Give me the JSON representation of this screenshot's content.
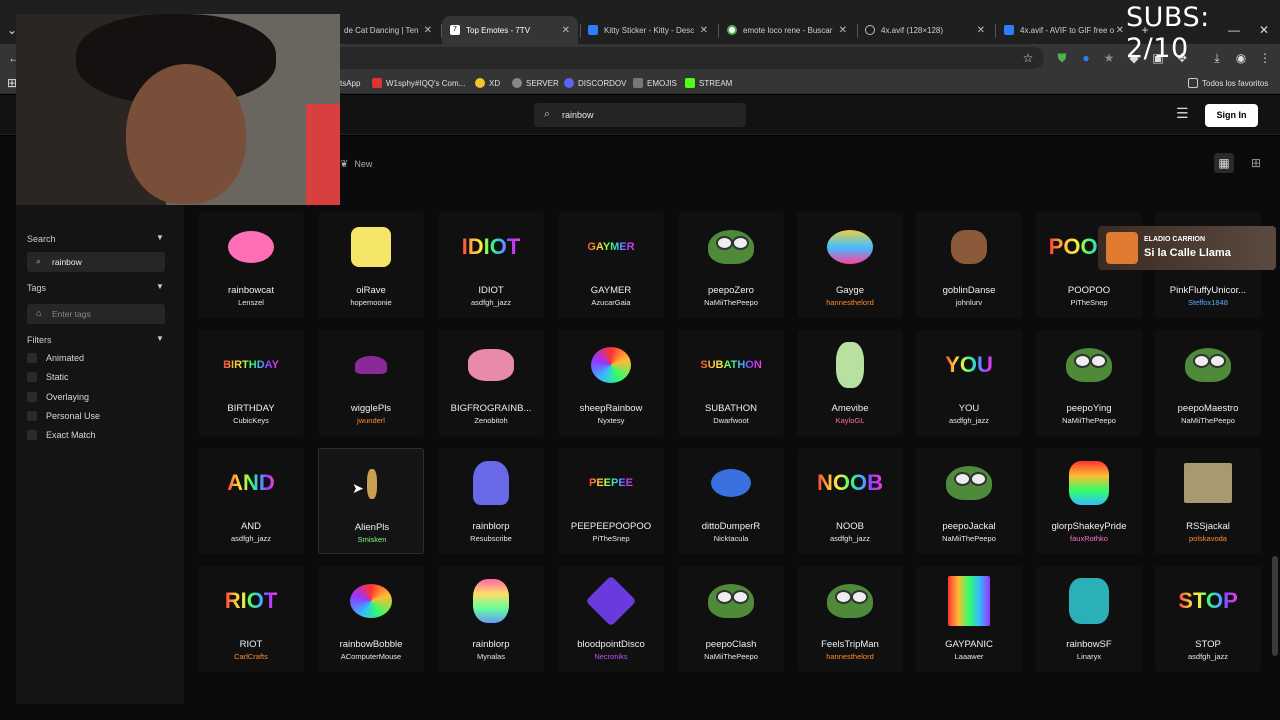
{
  "overlay": {
    "subs_counter": "SUBS: 2/10",
    "notification_title": "ELADIO CARRION",
    "notification_song": "Si la Calle Llama"
  },
  "browser": {
    "tabs": [
      {
        "label": "de Cat Dancing | Ten",
        "active": false,
        "color": "#666"
      },
      {
        "label": "Top Emotes - 7TV",
        "active": true,
        "color": "#29b6f6"
      },
      {
        "label": "Kitty Sticker - Kitty - Desc",
        "active": false,
        "color": "#2f7dff"
      },
      {
        "label": "emote loco rene - Buscar",
        "active": false,
        "color": "#4caf50"
      },
      {
        "label": "4x.avif (128×128)",
        "active": false,
        "color": "#999"
      },
      {
        "label": "4x.avif - AVIF to GIF free o",
        "active": false,
        "color": "#2f7dff"
      }
    ],
    "bookmarks": [
      {
        "label": "tsApp",
        "color": "#25d366"
      },
      {
        "label": "W1sphy#IQQ's Com...",
        "color": "#d33"
      },
      {
        "label": "XD",
        "color": "#f4c430"
      },
      {
        "label": "SERVER",
        "color": "#888"
      },
      {
        "label": "DISCORDOV",
        "color": "#5865f2"
      },
      {
        "label": "EMOJIS",
        "color": "#777"
      },
      {
        "label": "STREAM",
        "color": "#53fc18"
      }
    ],
    "all_bookmarks": "Todos los favoritos"
  },
  "header": {
    "search_value": "rainbow",
    "signin_label": "Sign In"
  },
  "subnav": {
    "new_label": "New"
  },
  "sidebar": {
    "search_title": "Search",
    "search_value": "rainbow",
    "tags_title": "Tags",
    "tags_placeholder": "Enter tags",
    "filters_title": "Filters",
    "filters": [
      "Animated",
      "Static",
      "Overlaying",
      "Personal Use",
      "Exact Match"
    ]
  },
  "emotes": [
    {
      "name": "rainbowcat",
      "owner": "Lenszel",
      "owner_color": "#e8e8e8"
    },
    {
      "name": "oiRave",
      "owner": "hopemoonie",
      "owner_color": "#e8e8e8"
    },
    {
      "name": "IDIOT",
      "owner": "asdfgh_jazz",
      "owner_color": "#e8e8e8"
    },
    {
      "name": "GAYMER",
      "owner": "AzucarGaia",
      "owner_color": "#e8e8e8"
    },
    {
      "name": "peepoZero",
      "owner": "NaMiiThePeepo",
      "owner_color": "#e8e8e8"
    },
    {
      "name": "Gayge",
      "owner": "hannesthelord",
      "owner_color": "#ff8a2a"
    },
    {
      "name": "goblinDanse",
      "owner": "johnlurv",
      "owner_color": "#e8e8e8"
    },
    {
      "name": "POOPOO",
      "owner": "PiTheSnep",
      "owner_color": "#e8e8e8"
    },
    {
      "name": "PinkFluffyUnicor...",
      "owner": "Steffox1848",
      "owner_color": "#5aa9ff"
    },
    {
      "name": "BIRTHDAY",
      "owner": "CubicKeys",
      "owner_color": "#e8e8e8"
    },
    {
      "name": "wigglePls",
      "owner": "jwunderl",
      "owner_color": "#ff8a2a"
    },
    {
      "name": "BIGFROGRAINB...",
      "owner": "Zenobitoh",
      "owner_color": "#e8e8e8"
    },
    {
      "name": "sheepRainbow",
      "owner": "Nyxtesy",
      "owner_color": "#e8e8e8"
    },
    {
      "name": "SUBATHON",
      "owner": "Dwarfwoot",
      "owner_color": "#e8e8e8"
    },
    {
      "name": "Amevibe",
      "owner": "KayloGL",
      "owner_color": "#ff6fa8"
    },
    {
      "name": "YOU",
      "owner": "asdfgh_jazz",
      "owner_color": "#e8e8e8"
    },
    {
      "name": "peepoYing",
      "owner": "NaMiiThePeepo",
      "owner_color": "#e8e8e8"
    },
    {
      "name": "peepoMaestro",
      "owner": "NaMiiThePeepo",
      "owner_color": "#e8e8e8"
    },
    {
      "name": "AND",
      "owner": "asdfgh_jazz",
      "owner_color": "#e8e8e8"
    },
    {
      "name": "AlienPls",
      "owner": "Smisken",
      "owner_color": "#7cff7c"
    },
    {
      "name": "rainblorp",
      "owner": "Resubscribe",
      "owner_color": "#e8e8e8"
    },
    {
      "name": "PEEPEEPOOPOO",
      "owner": "PiTheSnep",
      "owner_color": "#e8e8e8"
    },
    {
      "name": "dittoDumperR",
      "owner": "Nicktacula",
      "owner_color": "#e8e8e8"
    },
    {
      "name": "NOOB",
      "owner": "asdfgh_jazz",
      "owner_color": "#e8e8e8"
    },
    {
      "name": "peepoJackal",
      "owner": "NaMiiThePeepo",
      "owner_color": "#e8e8e8"
    },
    {
      "name": "glorpShakeyPride",
      "owner": "fauxRothko",
      "owner_color": "#ff6fd8"
    },
    {
      "name": "RSSjackal",
      "owner": "polskavoda",
      "owner_color": "#ff8a2a"
    },
    {
      "name": "RIOT",
      "owner": "CarlCrafts",
      "owner_color": "#ff8a2a"
    },
    {
      "name": "rainbowBobble",
      "owner": "AComputerMouse",
      "owner_color": "#e8e8e8"
    },
    {
      "name": "rainblorp",
      "owner": "Mynalas",
      "owner_color": "#e8e8e8"
    },
    {
      "name": "bloodpointDisco",
      "owner": "Necroniks",
      "owner_color": "#c050ff"
    },
    {
      "name": "peepoClash",
      "owner": "NaMiiThePeepo",
      "owner_color": "#e8e8e8"
    },
    {
      "name": "FeelsTripMan",
      "owner": "hannesthelord",
      "owner_color": "#ff8a2a"
    },
    {
      "name": "GAYPANIC",
      "owner": "Laaawer",
      "owner_color": "#e8e8e8"
    },
    {
      "name": "rainbowSF",
      "owner": "Linaryx",
      "owner_color": "#e8e8e8"
    },
    {
      "name": "STOP",
      "owner": "asdfgh_jazz",
      "owner_color": "#e8e8e8"
    }
  ]
}
